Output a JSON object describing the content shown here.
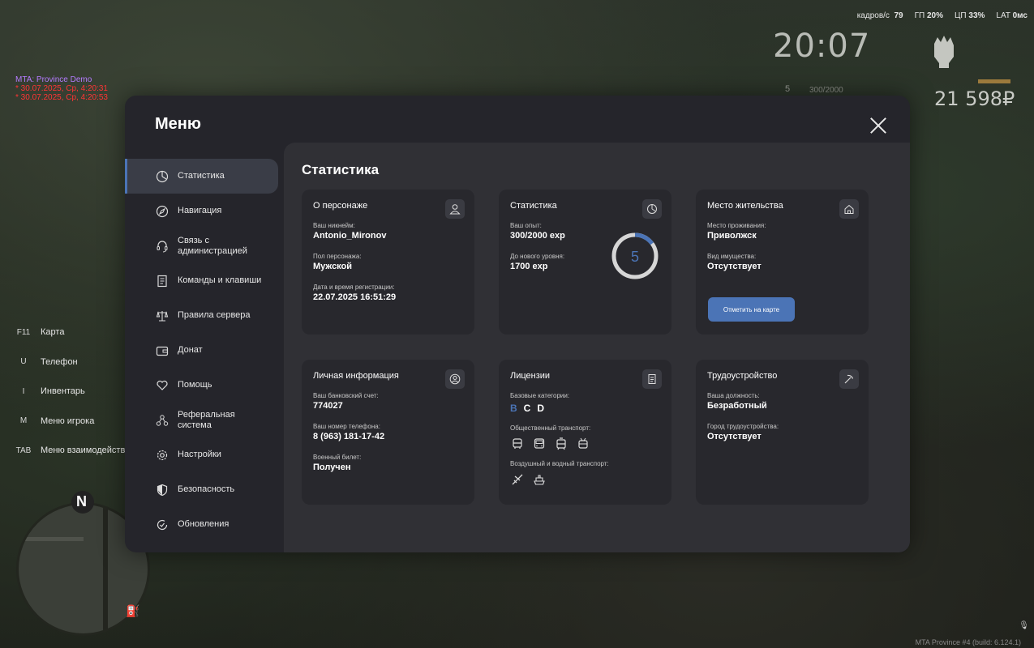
{
  "hud": {
    "fps_label": "кадров/с",
    "fps_value": "79",
    "gpu_label": "ГП",
    "gpu_value": "20%",
    "cpu_label": "ЦП",
    "cpu_value": "33%",
    "lat_label": "LAT",
    "lat_value": "0мс",
    "clock": "20:07",
    "level": "5",
    "exp": "300/2000",
    "money": "21 598₽"
  },
  "logs": {
    "title": "MTA: Province Demo",
    "lines": [
      "* 30.07.2025, Ср, 4:20:31",
      "* 30.07.2025, Ср, 4:20:53"
    ]
  },
  "hotkeys": [
    {
      "key": "F11",
      "label": "Карта"
    },
    {
      "key": "U",
      "label": "Телефон"
    },
    {
      "key": "I",
      "label": "Инвентарь"
    },
    {
      "key": "M",
      "label": "Меню игрока"
    },
    {
      "key": "TAB",
      "label": "Меню взаимодействия"
    }
  ],
  "minimap": {
    "compass": "N"
  },
  "build": "MTA Province #4 (build: 6.124.1)",
  "menu": {
    "title": "Меню",
    "nav": [
      {
        "label": "Статистика",
        "icon": "pie-chart-icon",
        "active": true
      },
      {
        "label": "Навигация",
        "icon": "compass-icon"
      },
      {
        "label": "Связь с администрацией",
        "icon": "headset-icon"
      },
      {
        "label": "Команды и клавиши",
        "icon": "document-icon"
      },
      {
        "label": "Правила сервера",
        "icon": "scales-icon"
      },
      {
        "label": "Донат",
        "icon": "wallet-icon"
      },
      {
        "label": "Помощь",
        "icon": "heart-hand-icon"
      },
      {
        "label": "Реферальная система",
        "icon": "referral-icon"
      },
      {
        "label": "Настройки",
        "icon": "gear-icon"
      },
      {
        "label": "Безопасность",
        "icon": "shield-icon"
      },
      {
        "label": "Обновления",
        "icon": "refresh-check-icon"
      }
    ],
    "content_title": "Статистика",
    "cards": {
      "character": {
        "title": "О персонаже",
        "nick_label": "Ваш никнейм:",
        "nick": "Antonio_Mironov",
        "sex_label": "Пол персонажа:",
        "sex": "Мужской",
        "reg_label": "Дата и время регистрации:",
        "reg": "22.07.2025 16:51:29"
      },
      "stats": {
        "title": "Статистика",
        "exp_label": "Ваш опыт:",
        "exp": "300/2000 exp",
        "next_label": "До нового уровня:",
        "next": "1700 exp",
        "level": "5",
        "progress": 0.15
      },
      "residence": {
        "title": "Место жительства",
        "place_label": "Место проживания:",
        "place": "Приволжск",
        "property_label": "Вид имущества:",
        "property": "Отсутствует",
        "button": "Отметить на карте"
      },
      "personal": {
        "title": "Личная информация",
        "bank_label": "Ваш банковский счет:",
        "bank": "774027",
        "phone_label": "Ваш номер телефона:",
        "phone": "8 (963) 181-17-42",
        "military_label": "Военный билет:",
        "military": "Получен"
      },
      "licenses": {
        "title": "Лицензии",
        "base_label": "Базовые категории:",
        "categories": [
          "B",
          "C",
          "D"
        ],
        "public_label": "Общественный транспорт:",
        "air_label": "Воздушный и водный транспорт:"
      },
      "job": {
        "title": "Трудоустройство",
        "position_label": "Ваша должность:",
        "position": "Безработный",
        "city_label": "Город трудоустройства:",
        "city": "Отсутствует"
      }
    }
  }
}
